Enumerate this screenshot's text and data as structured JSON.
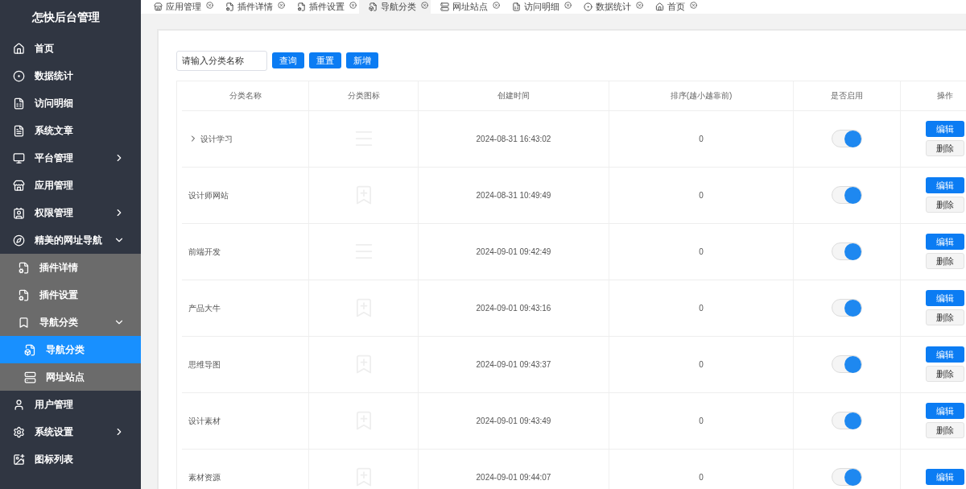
{
  "sidebar": {
    "title": "怎快后台管理",
    "items": [
      {
        "label": "首页",
        "selected": false
      },
      {
        "label": "数据统计",
        "selected": false
      },
      {
        "label": "访问明细",
        "selected": false
      },
      {
        "label": "系统文章",
        "selected": false
      },
      {
        "label": "平台管理",
        "selected": false,
        "expanded": false
      },
      {
        "label": "应用管理",
        "selected": false
      },
      {
        "label": "权限管理",
        "selected": false,
        "expanded": false
      },
      {
        "label": "精美的网址导航",
        "selected": false,
        "expanded": true,
        "children": [
          {
            "label": "插件详情",
            "selected": false
          },
          {
            "label": "插件设置",
            "selected": false
          },
          {
            "label": "导航分类",
            "selected": false,
            "expanded": true,
            "children": [
              {
                "label": "导航分类",
                "selected": true
              },
              {
                "label": "网址站点",
                "selected": false
              }
            ]
          }
        ]
      },
      {
        "label": "用户管理",
        "selected": false
      },
      {
        "label": "系统设置",
        "selected": false,
        "expanded": false
      },
      {
        "label": "图标列表",
        "selected": false
      }
    ]
  },
  "tabs": [
    {
      "label": "应用管理",
      "selected": false
    },
    {
      "label": "插件详情",
      "selected": false
    },
    {
      "label": "插件设置",
      "selected": false
    },
    {
      "label": "导航分类",
      "selected": true
    },
    {
      "label": "网址站点",
      "selected": false
    },
    {
      "label": "访问明细",
      "selected": false
    },
    {
      "label": "数据统计",
      "selected": false
    },
    {
      "label": "首页",
      "selected": false
    }
  ],
  "search": {
    "placeholder": "请输入分类名称"
  },
  "buttons": [
    "查询",
    "重置",
    "新增"
  ],
  "table": {
    "columns": [
      "分类名称",
      "分类图标",
      "创建时间",
      "排序(越小越靠前)",
      "是否启用",
      "操作"
    ],
    "rows": [
      {
        "name": "设计学习",
        "expandable": true,
        "kind": "lines",
        "created": "2024-08-31 16:43:02",
        "sort": "0",
        "on": true,
        "edit": "编辑",
        "delete": "删除"
      },
      {
        "name": "设计师网站",
        "expandable": false,
        "kind": "bookmark",
        "created": "2024-08-31 10:49:49",
        "sort": "0",
        "on": true,
        "edit": "编辑",
        "delete": "删除"
      },
      {
        "name": "前端开发",
        "expandable": false,
        "kind": "lines",
        "created": "2024-09-01 09:42:49",
        "sort": "0",
        "on": true,
        "edit": "编辑",
        "delete": "删除"
      },
      {
        "name": "产品大牛",
        "expandable": false,
        "kind": "bookmark",
        "created": "2024-09-01 09:43:16",
        "sort": "0",
        "on": true,
        "edit": "编辑",
        "delete": "删除"
      },
      {
        "name": "思维导图",
        "expandable": false,
        "kind": "bookmark",
        "created": "2024-09-01 09:43:37",
        "sort": "0",
        "on": true,
        "edit": "编辑",
        "delete": "删除"
      },
      {
        "name": "设计素材",
        "expandable": false,
        "kind": "bookmark",
        "created": "2024-09-01 09:43:49",
        "sort": "0",
        "on": true,
        "edit": "编辑",
        "delete": "删除"
      },
      {
        "name": "素材资源",
        "expandable": false,
        "kind": "bookmark",
        "created": "2024-09-01 09:44:07",
        "sort": "0",
        "on": true,
        "edit": "编辑"
      }
    ]
  }
}
